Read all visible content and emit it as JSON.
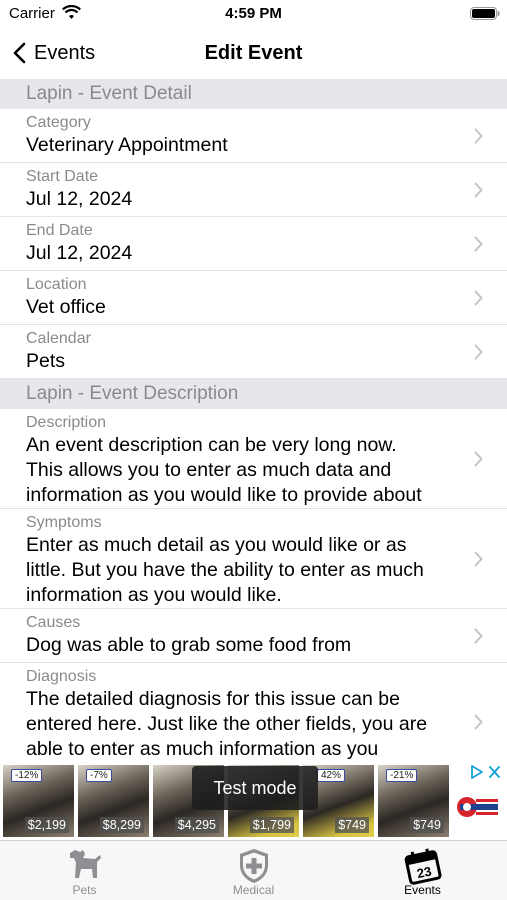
{
  "status_bar": {
    "carrier": "Carrier",
    "time": "4:59 PM"
  },
  "nav": {
    "back_label": "Events",
    "title": "Edit Event"
  },
  "sections": [
    {
      "header": "Lapin - Event Detail"
    },
    {
      "header": "Lapin - Event Description"
    }
  ],
  "detail_rows": [
    {
      "label": "Category",
      "value": "Veterinary Appointment"
    },
    {
      "label": "Start Date",
      "value": "Jul 12, 2024"
    },
    {
      "label": "End Date",
      "value": "Jul 12, 2024"
    },
    {
      "label": "Location",
      "value": "Vet office"
    },
    {
      "label": "Calendar",
      "value": "Pets"
    }
  ],
  "description_rows": [
    {
      "label": "Description",
      "value": "An event description can be very long now.\nThis allows you to enter as much data and\ninformation as you would like to provide about"
    },
    {
      "label": "Symptoms",
      "value": "Enter as much detail as you would like or as\nlittle. But you have the ability to enter as much\ninformation as you would like."
    },
    {
      "label": "Causes",
      "value": "Dog was able to grab some food from"
    },
    {
      "label": "Diagnosis",
      "value": "The detailed diagnosis for this issue can be\nentered here. Just like the other fields, you are\nable to enter as much information as you"
    }
  ],
  "ad": {
    "test_mode_label": "Test mode",
    "tiles": [
      {
        "discount": "-12%",
        "price": "$2,199"
      },
      {
        "discount": "-7%",
        "price": "$8,299"
      },
      {
        "discount": "",
        "price": "$4,295"
      },
      {
        "discount": "",
        "price": "$1,799"
      },
      {
        "discount": "42%",
        "price": "$749"
      },
      {
        "discount": "-21%",
        "price": "$749"
      }
    ]
  },
  "tabs": [
    {
      "label": "Pets",
      "icon": "dog-icon",
      "active": false
    },
    {
      "label": "Medical",
      "icon": "medical-shield-icon",
      "active": false
    },
    {
      "label": "Events",
      "icon": "calendar-icon",
      "active": true
    }
  ],
  "colors": {
    "section_header_bg": "#e6e6eb",
    "secondary_text": "#8a8a8e",
    "tab_inactive": "#8e8e93",
    "ad_accent": "#1aa3d9"
  }
}
